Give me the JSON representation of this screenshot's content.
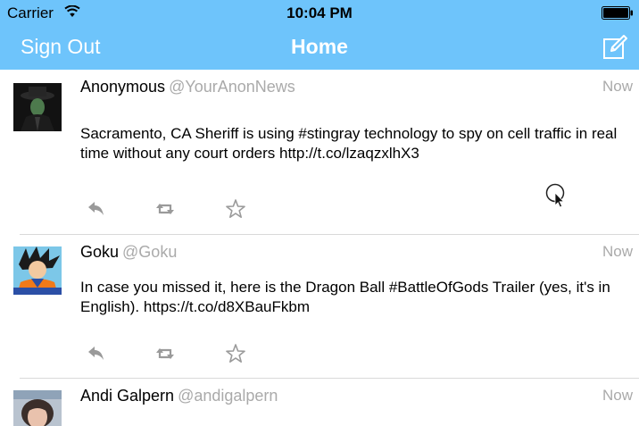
{
  "status_bar": {
    "carrier": "Carrier",
    "time": "10:04 PM",
    "wifi_icon": "wifi-icon",
    "battery_icon": "battery-icon"
  },
  "nav": {
    "sign_out_label": "Sign Out",
    "title": "Home",
    "compose_icon": "compose-icon",
    "background_color": "#6ec4fb"
  },
  "tweets": [
    {
      "name": "Anonymous",
      "handle": "@YourAnonNews",
      "time": "Now",
      "text": "Sacramento, CA Sheriff is using #stingray technology to spy on cell traffic in real time without any court orders http://t.co/lzaqzxlhX3"
    },
    {
      "name": "Goku",
      "handle": "@Goku",
      "time": "Now",
      "text": "In case you missed it, here is the Dragon Ball #BattleOfGods Trailer (yes, it's in English). https://t.co/d8XBauFkbm"
    },
    {
      "name": "Andi Galpern",
      "handle": "@andigalpern",
      "time": "Now",
      "text": ""
    }
  ],
  "action_icons": [
    "reply-icon",
    "retweet-icon",
    "favorite-star-icon"
  ],
  "colors": {
    "muted_text": "#aaaaaa",
    "icon_gray": "#9a9a9a",
    "divider": "#d9d9d9"
  }
}
